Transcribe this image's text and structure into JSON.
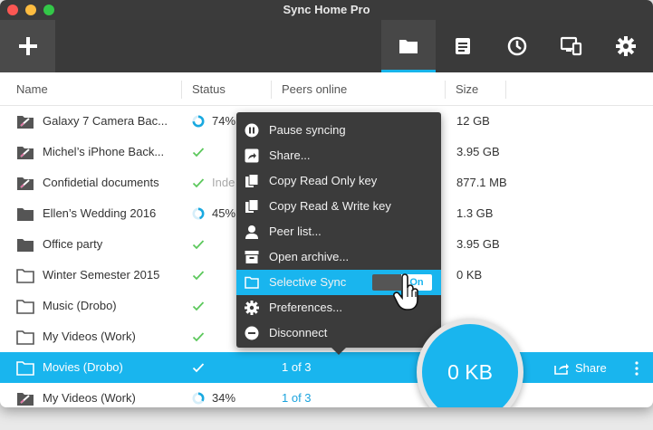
{
  "window": {
    "title": "Sync Home Pro"
  },
  "colors": {
    "accent": "#19b5ee",
    "toolbar": "#3a3a3a",
    "check": "#5cc85c"
  },
  "toolbar": {
    "add_icon": "plus-icon",
    "tools": [
      {
        "name": "folder-icon",
        "active": true
      },
      {
        "name": "document-icon",
        "active": false
      },
      {
        "name": "clock-icon",
        "active": false
      },
      {
        "name": "devices-icon",
        "active": false
      },
      {
        "name": "gear-icon",
        "active": false
      }
    ]
  },
  "columns": {
    "name": "Name",
    "status": "Status",
    "peers": "Peers online",
    "size": "Size"
  },
  "rows": [
    {
      "name": "Galaxy 7 Camera Bac...",
      "icon": "folder-broken-icon",
      "status": "progress",
      "status_text": "74%",
      "peers": "",
      "size": "12 GB",
      "progress": 0.74
    },
    {
      "name": "Michel’s iPhone Back...",
      "icon": "folder-broken-icon",
      "status": "check",
      "status_text": "",
      "peers": "",
      "size": "3.95 GB"
    },
    {
      "name": "Confidetial documents",
      "icon": "folder-broken-icon",
      "status": "check",
      "status_text": "Inde",
      "peers": "",
      "size": "877.1 MB"
    },
    {
      "name": "Ellen’s Wedding 2016",
      "icon": "folder-icon",
      "status": "progress",
      "status_text": "45%",
      "peers": "",
      "size": "1.3 GB",
      "progress": 0.45
    },
    {
      "name": "Office party",
      "icon": "folder-icon",
      "status": "check",
      "status_text": "",
      "peers": "",
      "size": "3.95 GB"
    },
    {
      "name": "Winter Semester 2015",
      "icon": "folder-outline-icon",
      "status": "check",
      "status_text": "",
      "peers": "",
      "size": "0 KB"
    },
    {
      "name": "Music (Drobo)",
      "icon": "folder-outline-icon",
      "status": "check",
      "status_text": "",
      "peers": "",
      "size": ""
    },
    {
      "name": "My Videos (Work)",
      "icon": "folder-outline-icon",
      "status": "check",
      "status_text": "",
      "peers": "",
      "size": ""
    },
    {
      "name": "Movies (Drobo)",
      "icon": "folder-outline-icon",
      "status": "check",
      "status_text": "",
      "peers": "1 of 3",
      "size": "",
      "selected": true
    },
    {
      "name": "My Videos (Work)",
      "icon": "folder-broken-icon",
      "status": "progress",
      "status_text": "34%",
      "peers": "1 of 3",
      "size": "",
      "progress": 0.34
    }
  ],
  "selected_row": {
    "share_label": "Share",
    "magnified_size": "0 KB"
  },
  "context_menu": {
    "items": [
      {
        "label": "Pause syncing",
        "icon": "pause-icon"
      },
      {
        "label": "Share...",
        "icon": "share-icon"
      },
      {
        "label": "Copy Read Only key",
        "icon": "copy-icon"
      },
      {
        "label": "Copy Read & Write key",
        "icon": "copy-icon"
      },
      {
        "label": "Peer list...",
        "icon": "user-icon"
      },
      {
        "label": "Open archive...",
        "icon": "archive-icon"
      },
      {
        "label": "Selective Sync",
        "icon": "folder-icon",
        "active": true,
        "toggle": "On"
      },
      {
        "label": "Preferences...",
        "icon": "gear-icon"
      },
      {
        "label": "Disconnect",
        "icon": "minus-circle-icon"
      }
    ]
  }
}
